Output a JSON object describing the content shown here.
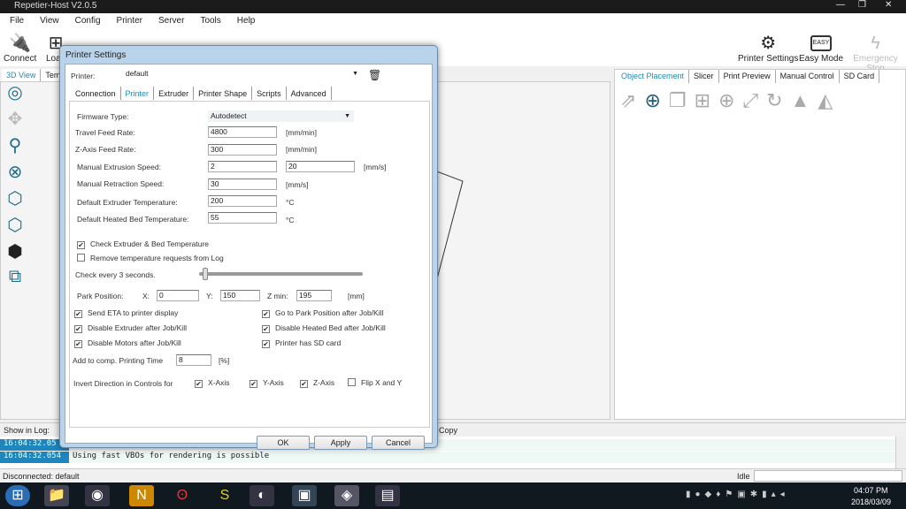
{
  "window": {
    "title": "Repetier-Host V2.0.5",
    "controls": [
      "—",
      "❐",
      "✕"
    ]
  },
  "menu": [
    "File",
    "View",
    "Config",
    "Printer",
    "Server",
    "Tools",
    "Help"
  ],
  "toolbar": {
    "connect": "Connect",
    "load": "Load",
    "printer_settings": "Printer Settings",
    "easy_mode": "Easy Mode",
    "easy_badge": "EASY",
    "emergency_stop": "Emergency Stop"
  },
  "left_tabs": [
    "3D View",
    "Temp"
  ],
  "right_tabs": [
    "Object Placement",
    "Slicer",
    "Print Preview",
    "Manual Control",
    "SD Card"
  ],
  "right_icons": [
    "export-icon",
    "add-object-icon",
    "copy-icon",
    "grid-icon",
    "center-icon",
    "scale-icon",
    "rotate-icon",
    "mountain-icon",
    "mirror-icon"
  ],
  "log": {
    "show_in_log": "Show in Log:",
    "copy": "Copy",
    "rows": [
      {
        "time": "16:04:32.05",
        "msg": ""
      },
      {
        "time": "16:04:32.054",
        "msg": "Using fast VBOs for rendering is possible"
      }
    ]
  },
  "status": {
    "left": "Disconnected: default",
    "right": "Idle"
  },
  "taskbar": {
    "time": "04:07 PM",
    "date": "2018/03/09"
  },
  "dialog": {
    "title": "Printer Settings",
    "printer_label": "Printer:",
    "printer_value": "default",
    "tabs": [
      "Connection",
      "Printer",
      "Extruder",
      "Printer Shape",
      "Scripts",
      "Advanced"
    ],
    "active_tab": "Printer",
    "firmware_label": "Firmware Type:",
    "firmware_value": "Autodetect",
    "fields": [
      {
        "label": "Travel Feed Rate:",
        "value": "4800",
        "unit": "[mm/min]"
      },
      {
        "label": "Z-Axis Feed Rate:",
        "value": "300",
        "unit": "[mm/min]"
      },
      {
        "label": "Manual Extrusion Speed:",
        "value": "2",
        "value2": "20",
        "unit": "[mm/s]"
      },
      {
        "label": "Manual Retraction Speed:",
        "value": "30",
        "unit": "[mm/s]"
      },
      {
        "label": "Default Extruder Temperature:",
        "value": "200",
        "unit": "°C"
      },
      {
        "label": "Default Heated Bed Temperature:",
        "value": "55",
        "unit": "°C"
      }
    ],
    "check_temp": {
      "label": "Check Extruder & Bed Temperature",
      "checked": true
    },
    "remove_temp": {
      "label": "Remove temperature requests from Log",
      "checked": false
    },
    "check_every": "Check every 3 seconds.",
    "slider_fraction": 0.0,
    "park": {
      "label": "Park Position:",
      "x_label": "X:",
      "x": "0",
      "y_label": "Y:",
      "y": "150",
      "z_label": "Z min:",
      "z": "195",
      "unit": "[mm]"
    },
    "checks_left": [
      {
        "label": "Send ETA to printer display",
        "checked": true
      },
      {
        "label": "Disable Extruder after Job/Kill",
        "checked": true
      },
      {
        "label": "Disable Motors after Job/Kill",
        "checked": true
      }
    ],
    "checks_right": [
      {
        "label": "Go to Park Position after Job/Kill",
        "checked": true
      },
      {
        "label": "Disable Heated Bed after Job/Kill",
        "checked": true
      },
      {
        "label": "Printer has SD card",
        "checked": true
      }
    ],
    "comp_time": {
      "label": "Add to comp. Printing Time",
      "value": "8",
      "unit": "[%]"
    },
    "invert": {
      "label": "Invert Direction in Controls for",
      "options": [
        {
          "label": "X-Axis",
          "checked": true
        },
        {
          "label": "Y-Axis",
          "checked": true
        },
        {
          "label": "Z-Axis",
          "checked": true
        },
        {
          "label": "Flip X and Y",
          "checked": false
        }
      ]
    },
    "buttons": {
      "ok": "OK",
      "apply": "Apply",
      "cancel": "Cancel"
    }
  }
}
